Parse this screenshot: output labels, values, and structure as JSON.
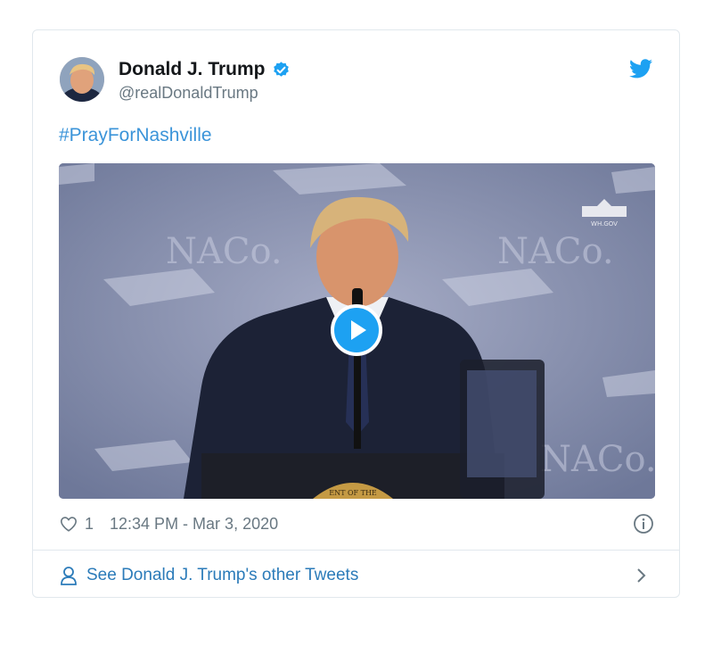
{
  "tweet": {
    "display_name": "Donald J. Trump",
    "handle": "@realDonaldTrump",
    "text": "#PrayForNashville",
    "like_count": "1",
    "timestamp": "12:34 PM - Mar 3, 2020",
    "verified": true
  },
  "media": {
    "watermark": "WH.GOV",
    "backdrop_logo": "NACo.",
    "seal_text": "ENT OF THE"
  },
  "footer": {
    "more_tweets_label": "See Donald J. Trump's other Tweets"
  },
  "icons": {
    "verified": "verified-badge-icon",
    "twitter": "twitter-bird-icon",
    "heart": "heart-icon",
    "info": "info-icon",
    "person": "person-icon",
    "chevron": "chevron-right-icon",
    "play": "play-icon"
  },
  "colors": {
    "link": "#3b94d9",
    "footer_link": "#2b7bb9",
    "twitter_blue": "#1da1f2",
    "border": "#e1e8ed",
    "meta_gray": "#697882"
  }
}
